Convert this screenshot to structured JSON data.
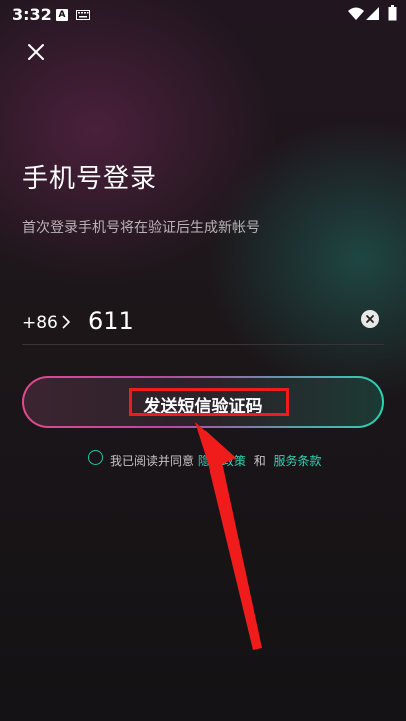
{
  "status_bar": {
    "time": "3:32",
    "notification_letter": "A"
  },
  "page": {
    "title": "手机号登录",
    "subtitle": "首次登录手机号将在验证后生成新帐号"
  },
  "phone": {
    "country_code": "+86",
    "value": "611"
  },
  "sms_button": {
    "label": "发送短信验证码"
  },
  "agreement": {
    "prefix": "我已阅读并同意",
    "privacy_link": "隐私政策",
    "and": "和",
    "terms_link": "服务条款"
  },
  "colors": {
    "accent_teal": "#2fd3b4",
    "accent_pink": "#e0498c",
    "highlight_red": "#f01c1c"
  },
  "icons": [
    "keyboard-icon",
    "wifi-icon",
    "signal-icon",
    "battery-icon",
    "close-icon",
    "chevron-right-icon",
    "clear-icon"
  ]
}
